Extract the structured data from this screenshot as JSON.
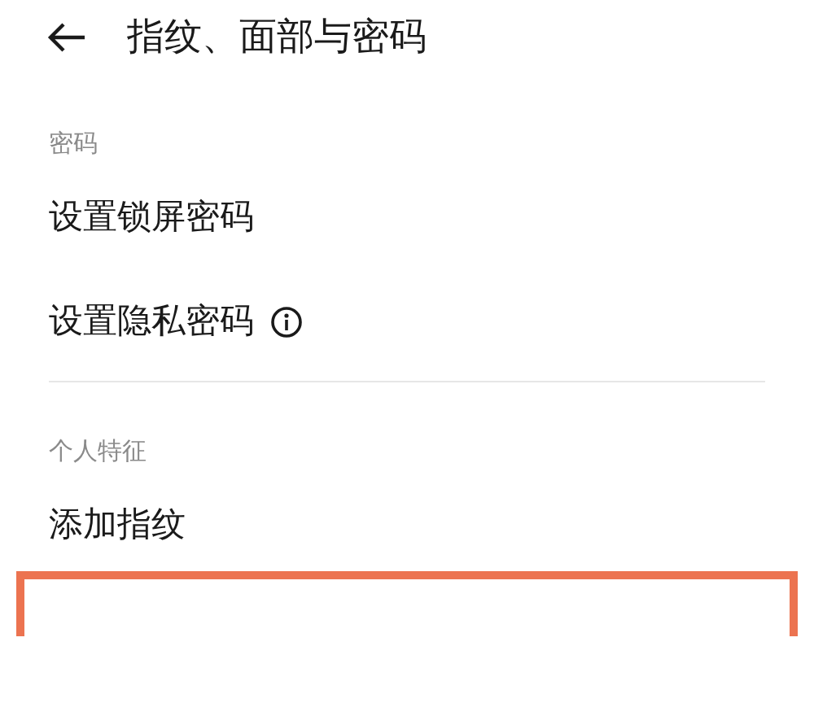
{
  "header": {
    "title": "指纹、面部与密码"
  },
  "sections": [
    {
      "heading": "密码",
      "items": [
        {
          "label": "设置锁屏密码",
          "info": false
        },
        {
          "label": "设置隐私密码",
          "info": true
        }
      ]
    },
    {
      "heading": "个人特征",
      "items": [
        {
          "label": "添加指纹",
          "info": false
        }
      ]
    }
  ]
}
